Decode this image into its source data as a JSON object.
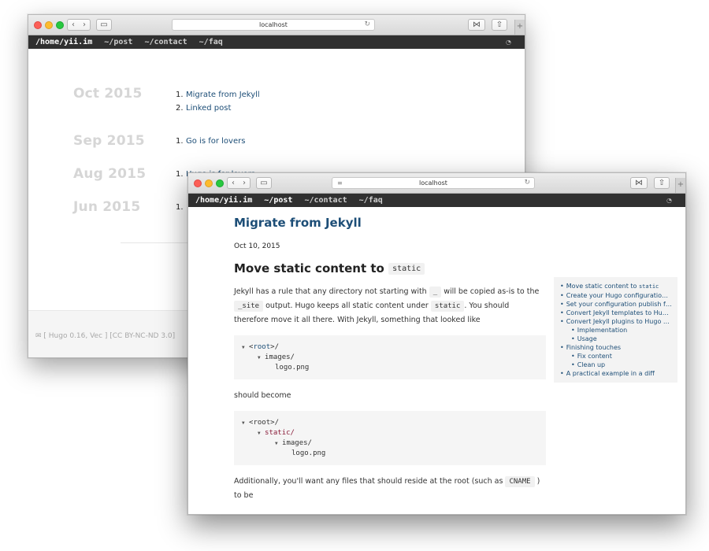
{
  "back_window": {
    "address": "localhost",
    "nav": [
      "/home/yii.im",
      "~/post",
      "~/contact",
      "~/faq"
    ],
    "archive": [
      {
        "month": "Oct 2015",
        "posts": [
          {
            "num": "1.",
            "title": "Migrate from Jekyll"
          },
          {
            "num": "2.",
            "title": "Linked post"
          }
        ]
      },
      {
        "month": "Sep 2015",
        "posts": [
          {
            "num": "1.",
            "title": "Go is for lovers"
          }
        ]
      },
      {
        "month": "Aug 2015",
        "posts": [
          {
            "num": "1.",
            "title": "Hugo is for lovers"
          }
        ]
      },
      {
        "month": "Jun 2015",
        "posts": [
          {
            "num": "1.",
            "title": ""
          }
        ]
      }
    ],
    "footer": "✉ [ Hugo 0.16, Vec ] [CC BY-NC-ND 3.0]"
  },
  "front_window": {
    "address": "localhost",
    "nav": [
      "/home/yii.im",
      "~/post",
      "~/contact",
      "~/faq"
    ],
    "post": {
      "title": "Migrate from Jekyll",
      "date": "Oct 10, 2015",
      "heading_text": "Move static content to",
      "heading_code": "static",
      "para1": {
        "t1": "Jekyll has a rule that any directory not starting with",
        "c1": "_",
        "t2": "will be copied as-is to the",
        "c2": "_site",
        "t3": "output. Hugo keeps all static content under",
        "c3": "static",
        "t4": ". You should therefore move it all there. With Jekyll, something that looked like"
      },
      "code1": {
        "l1_root": "root",
        "l2": "images/",
        "l3": "logo.png"
      },
      "should_become": "should become",
      "code2": {
        "l1_root": "root",
        "l2": "static/",
        "l3": "images/",
        "l4": "logo.png"
      },
      "para2": {
        "t1": "Additionally, you'll want any files that should reside at the root (such as",
        "c1": "CNAME",
        "t2": ") to be"
      }
    },
    "toc": [
      {
        "text": "Move static content to ",
        "code": "static"
      },
      {
        "text": "Create your Hugo configuration file"
      },
      {
        "text": "Set your configuration publish folder to _site"
      },
      {
        "text": "Convert Jekyll templates to Hugo templates"
      },
      {
        "text": "Convert Jekyll plugins to Hugo shortcodes"
      },
      {
        "text": "Implementation",
        "sub": true
      },
      {
        "text": "Usage",
        "sub": true
      },
      {
        "text": "Finishing touches"
      },
      {
        "text": "Fix content",
        "sub": true
      },
      {
        "text": "Clean up",
        "sub": true
      },
      {
        "text": "A practical example in a diff"
      }
    ]
  },
  "colors": {
    "link": "#1d4e77",
    "navbar": "#303030",
    "month": "#d6d6d6"
  }
}
